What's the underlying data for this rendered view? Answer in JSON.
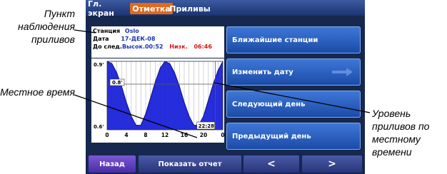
{
  "tabs": {
    "home": "Гл. экран",
    "mark": "Отметка",
    "tides": "Приливы"
  },
  "info": {
    "station_label": "Станция",
    "station_value": "Oslo",
    "date_label": "Дата",
    "date_value": "17-ДЕК-08",
    "next_label": "До след.",
    "high_label": "Высок.",
    "high_value": "00:52",
    "low_label": "Низк.",
    "low_value": "06:46"
  },
  "chart_data": {
    "type": "area",
    "title": "",
    "xlabel": "",
    "ylabel": "",
    "ticks_x": [
      "0",
      "4",
      "8",
      "12",
      "16",
      "20",
      "0"
    ],
    "xlim": [
      0,
      24
    ],
    "ylim": [
      0.6,
      0.9
    ],
    "y_top_label": "0.9'",
    "y_bottom_label": "0.6'",
    "current_level_label": "0.8'",
    "current_time_label": "22:28",
    "current_level": 0.8,
    "current_time_h": 22.47,
    "series": [
      {
        "x": [
          0,
          1,
          2,
          3,
          4,
          5,
          6,
          7,
          8,
          9,
          10,
          11,
          12,
          13,
          14,
          15,
          16,
          17,
          18,
          19,
          20,
          21,
          22,
          23,
          24
        ],
        "y": [
          0.9,
          0.89,
          0.85,
          0.79,
          0.72,
          0.66,
          0.62,
          0.62,
          0.67,
          0.74,
          0.81,
          0.87,
          0.9,
          0.89,
          0.85,
          0.79,
          0.72,
          0.66,
          0.62,
          0.62,
          0.66,
          0.73,
          0.8,
          0.86,
          0.9
        ]
      }
    ]
  },
  "buttons": {
    "nearest": "Ближайшие станции",
    "change_date": "Изменить дату",
    "next_day": "Следующий день",
    "prev_day": "Предыдущий день"
  },
  "bottom": {
    "back": "Назад",
    "report": "Показать отчет",
    "prev": "<",
    "next": ">"
  },
  "callouts": {
    "station": "Пункт наблюдения приливов",
    "local_time": "Местное время",
    "tide_level": "Уровень приливов по местному времени"
  },
  "colors": {
    "accent": "#e06a1e",
    "tide_fill": "#1a22d8",
    "button": "#2a5ec0"
  }
}
